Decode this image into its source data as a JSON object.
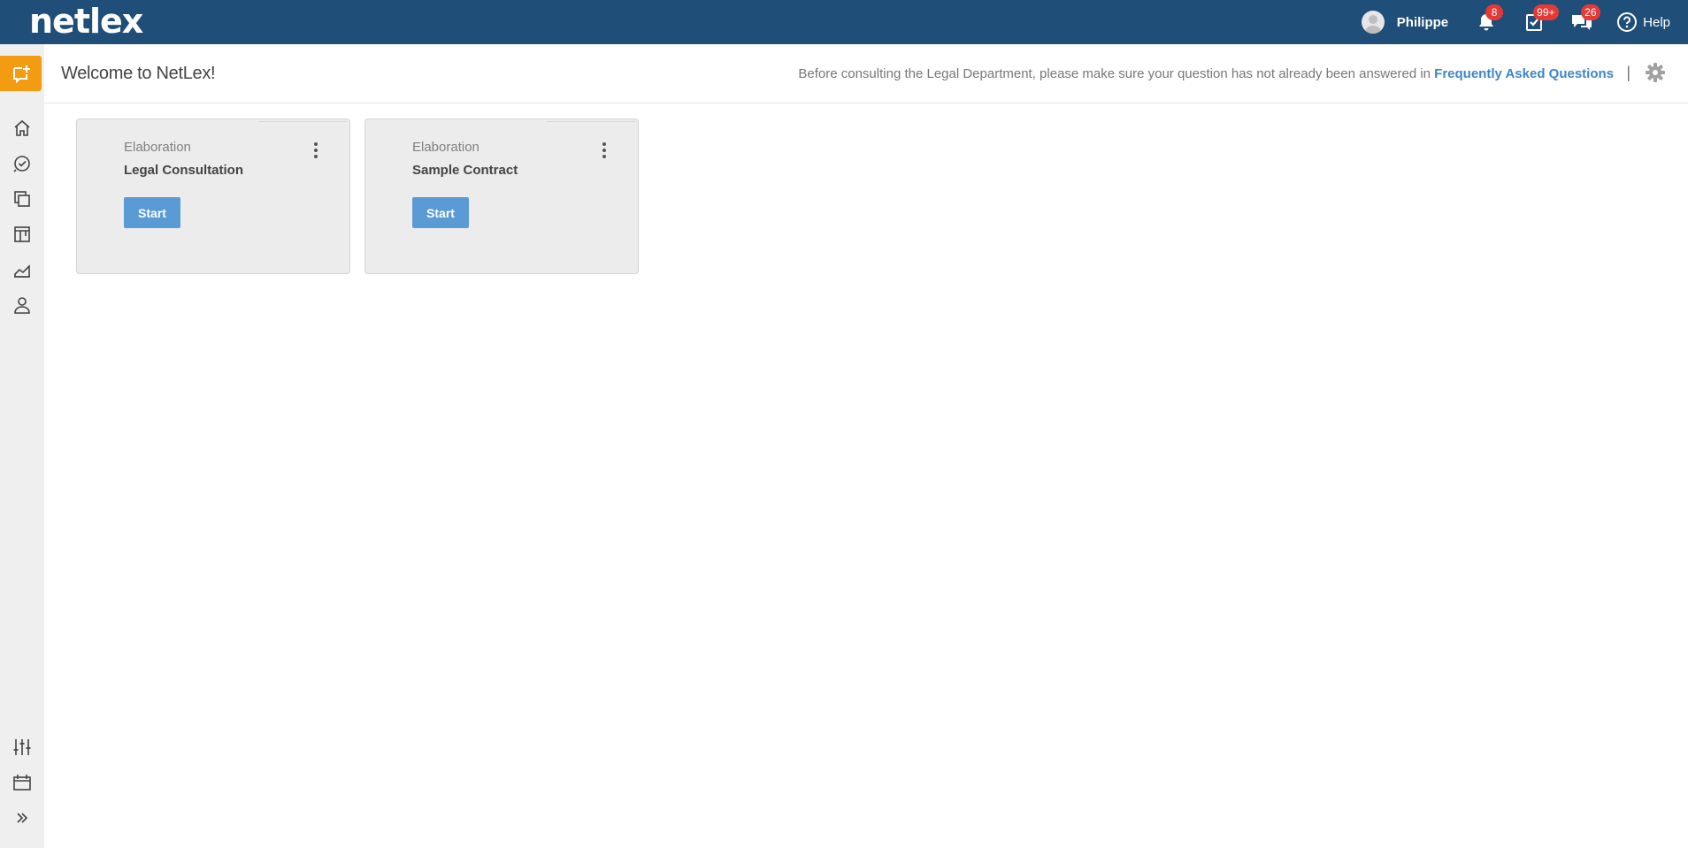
{
  "app": {
    "logo": "netlex"
  },
  "topbar": {
    "user_name": "Philippe",
    "notifications_count": "8",
    "tasks_count": "99+",
    "messages_count": "26",
    "help_label": "Help"
  },
  "header": {
    "title": "Welcome to NetLex!",
    "faq_prefix": "Before consulting the Legal Department, please make sure your question has not already been answered in",
    "faq_link": "Frequently Asked Questions",
    "separator": "|"
  },
  "sidebar": {
    "items": [
      {
        "icon": "home-icon"
      },
      {
        "icon": "tasks-check-icon"
      },
      {
        "icon": "documents-copy-icon"
      },
      {
        "icon": "board-icon"
      },
      {
        "icon": "chart-icon"
      },
      {
        "icon": "user-icon"
      }
    ],
    "bottom_items": [
      {
        "icon": "sliders-icon"
      },
      {
        "icon": "calendar-icon"
      },
      {
        "icon": "expand-icon"
      }
    ]
  },
  "cards": [
    {
      "phase": "Elaboration",
      "title": "Legal Consultation",
      "button": "Start"
    },
    {
      "phase": "Elaboration",
      "title": "Sample Contract",
      "button": "Start"
    }
  ],
  "colors": {
    "topbar": "#1f4e79",
    "accent": "#f39c12",
    "button": "#5b9bd5",
    "badge": "#e53935",
    "link": "#3d86c6"
  }
}
